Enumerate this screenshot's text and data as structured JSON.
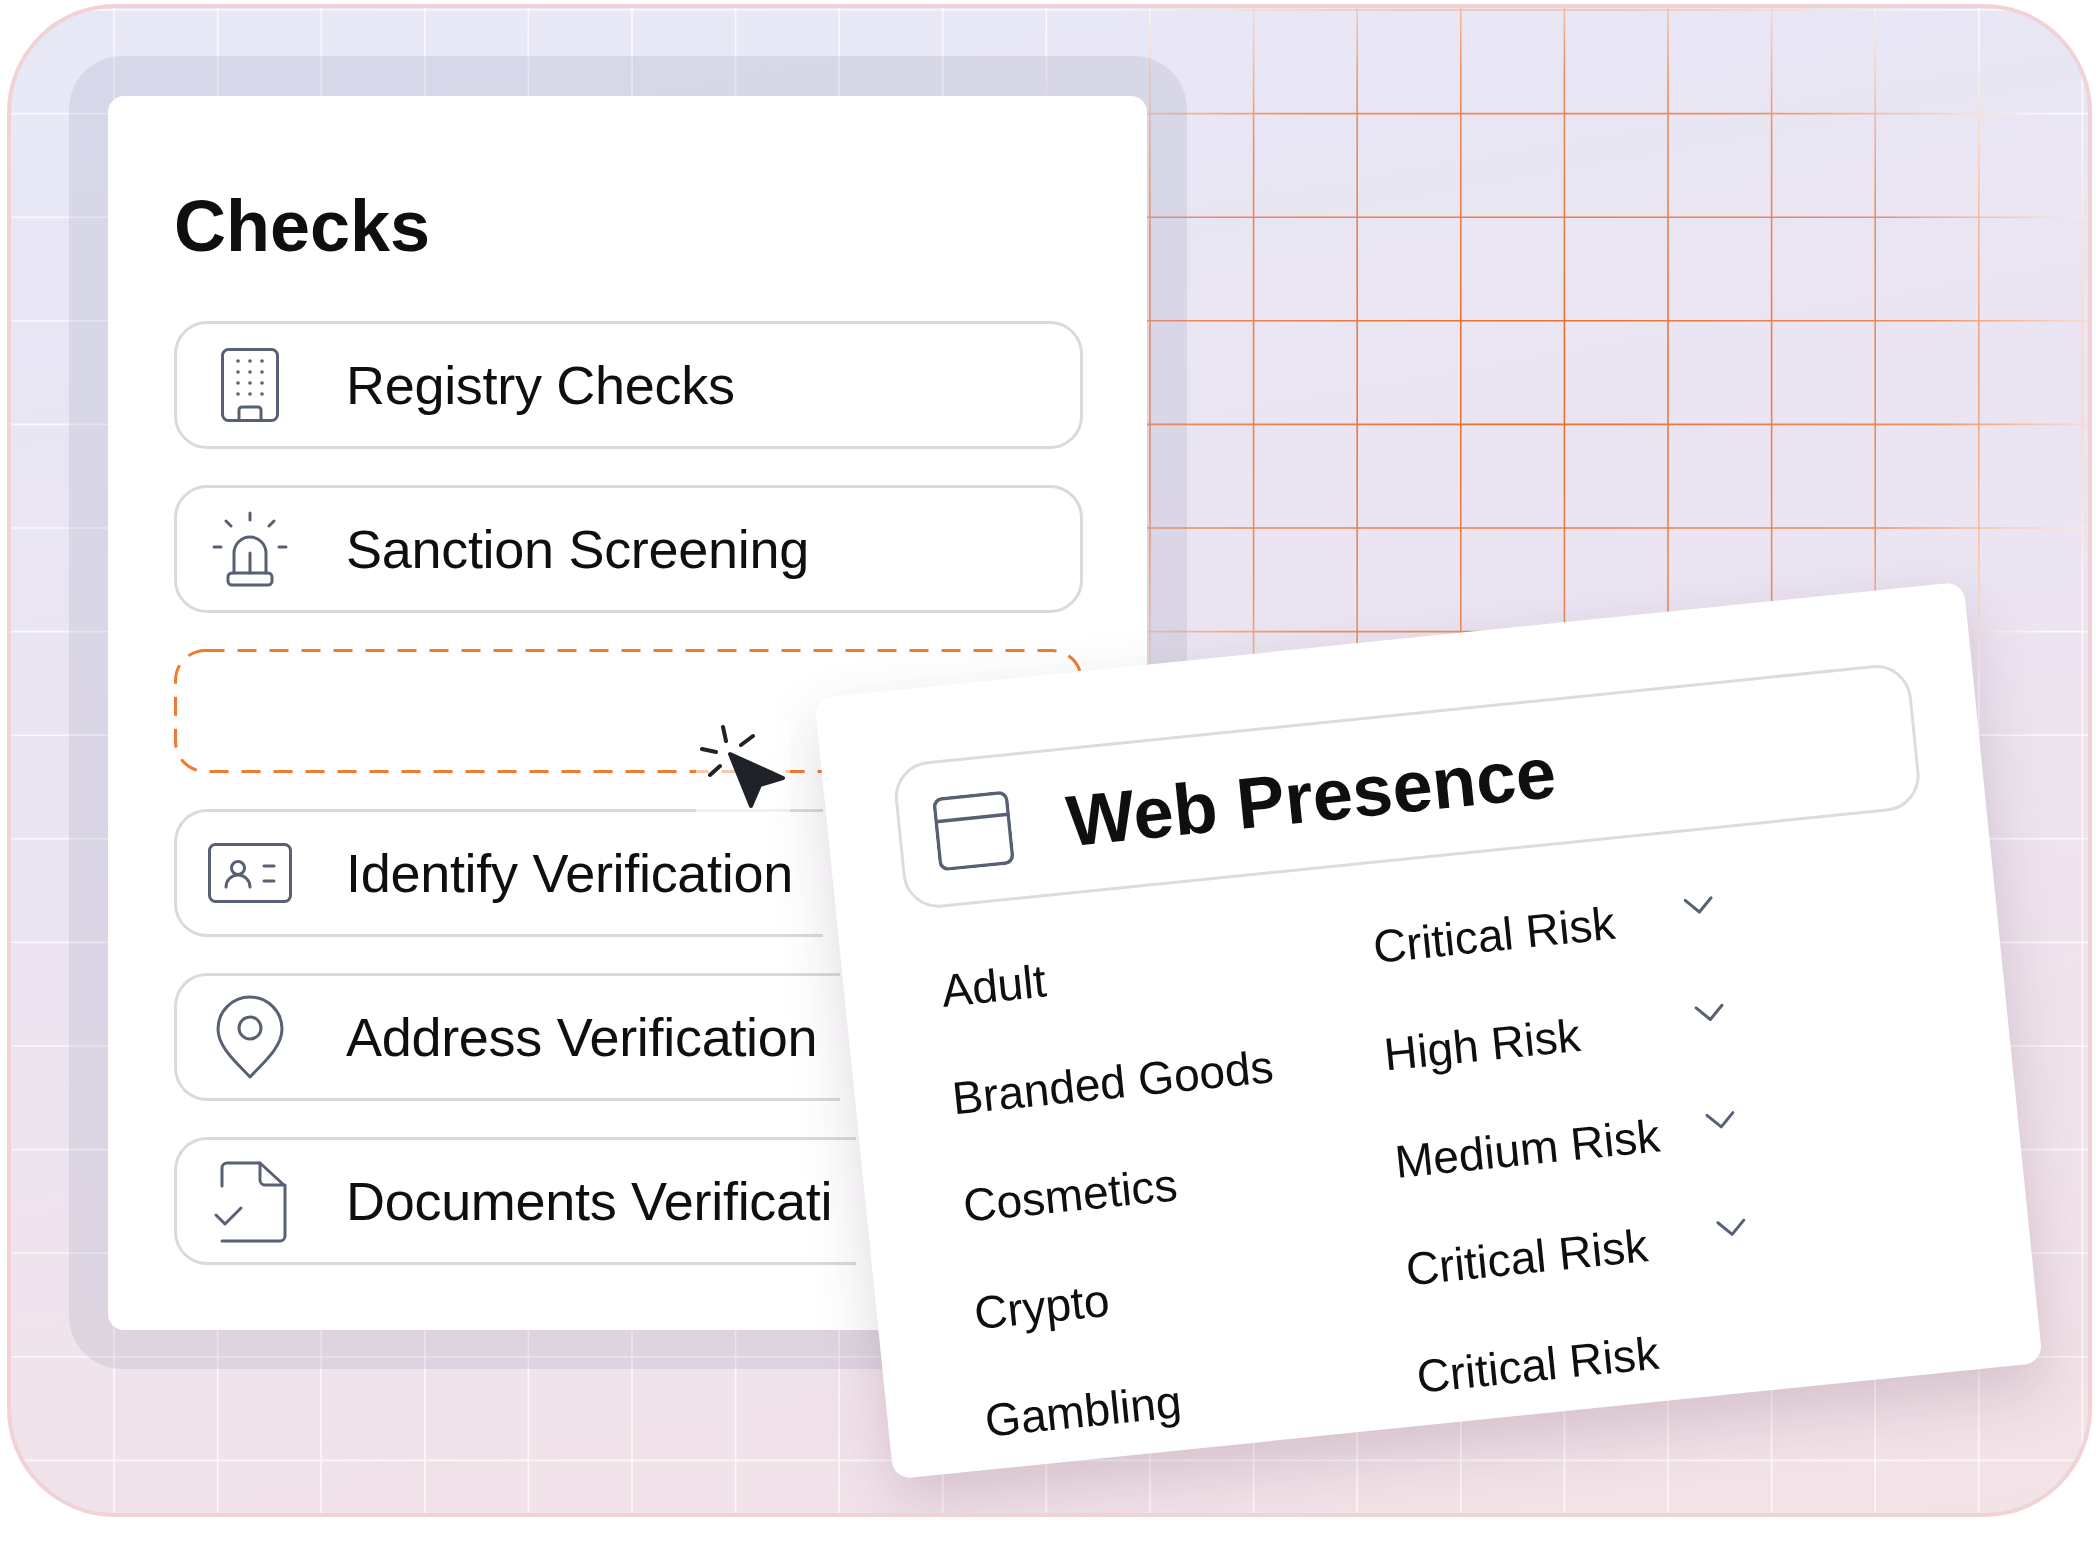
{
  "checks_panel": {
    "title": "Checks",
    "items": [
      {
        "kind": "registry",
        "label": "Registry Checks"
      },
      {
        "kind": "sanction",
        "label": "Sanction Screening"
      },
      {
        "kind": "slot"
      },
      {
        "kind": "identity",
        "label": "Identify Verification"
      },
      {
        "kind": "address",
        "label": "Address Verification"
      },
      {
        "kind": "documents",
        "label": "Documents Verificati"
      }
    ]
  },
  "web_presence_card": {
    "title": "Web Presence",
    "rows": [
      {
        "category": "Adult",
        "risk": "Critical Risk",
        "dropdown": true
      },
      {
        "category": "Branded Goods",
        "risk": "High Risk",
        "dropdown": true
      },
      {
        "category": "Cosmetics",
        "risk": "Medium Risk",
        "dropdown": true
      },
      {
        "category": "Crypto",
        "risk": "Critical Risk",
        "dropdown": true
      },
      {
        "category": "Gambling",
        "risk": "Critical Risk",
        "dropdown": false
      }
    ]
  }
}
